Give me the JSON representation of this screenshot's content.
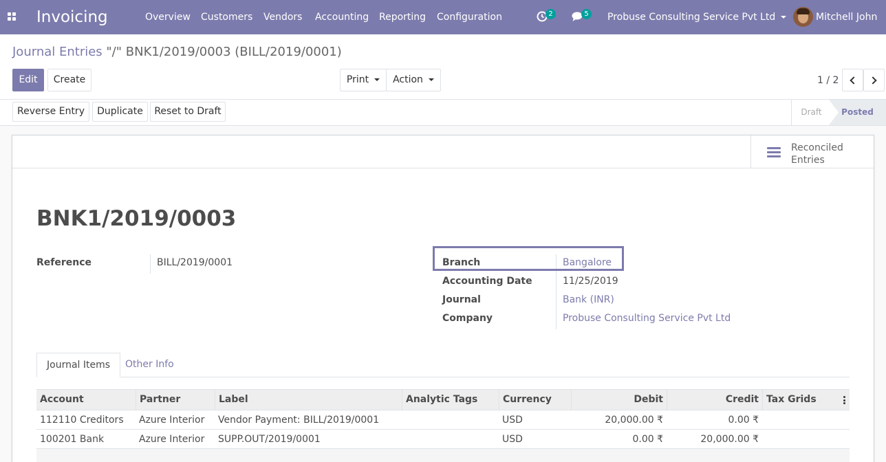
{
  "navbar": {
    "app_name": "Invoicing",
    "menu": [
      "Overview",
      "Customers",
      "Vendors",
      "Accounting",
      "Reporting",
      "Configuration"
    ],
    "activity_count": "2",
    "message_count": "5",
    "company": "Probuse Consulting Service Pvt Ltd",
    "user": "Mitchell John",
    "accent_color": "#7c7bad"
  },
  "breadcrumb": {
    "parent": "Journal Entries",
    "current": "\"/\" BNK1/2019/0003 (BILL/2019/0001)"
  },
  "buttons": {
    "edit": "Edit",
    "create": "Create",
    "print": "Print",
    "action": "Action",
    "reverse_entry": "Reverse Entry",
    "duplicate": "Duplicate",
    "reset_to_draft": "Reset to Draft"
  },
  "pager": {
    "value": "1 / 2"
  },
  "status": {
    "draft": "Draft",
    "posted": "Posted",
    "current": "Posted"
  },
  "smart_button": {
    "line1": "Reconciled",
    "line2": "Entries"
  },
  "record": {
    "name": "BNK1/2019/0003",
    "reference_label": "Reference",
    "reference": "BILL/2019/0001",
    "branch_label": "Branch",
    "branch": "Bangalore",
    "date_label": "Accounting Date",
    "date": "11/25/2019",
    "journal_label": "Journal",
    "journal": "Bank (INR)",
    "company_label": "Company",
    "company": "Probuse Consulting Service Pvt Ltd"
  },
  "tabs": {
    "journal_items": "Journal Items",
    "other_info": "Other Info",
    "active": "Journal Items"
  },
  "table": {
    "columns": [
      "Account",
      "Partner",
      "Label",
      "Analytic Tags",
      "Currency",
      "Debit",
      "Credit",
      "Tax Grids"
    ],
    "rows": [
      {
        "account": "112110 Creditors",
        "partner": "Azure Interior",
        "label": "Vendor Payment: BILL/2019/0001",
        "tags": "",
        "currency": "USD",
        "debit": "20,000.00 ₹",
        "credit": "0.00 ₹",
        "tax_grids": ""
      },
      {
        "account": "100201 Bank",
        "partner": "Azure Interior",
        "label": "SUPP.OUT/2019/0001",
        "tags": "",
        "currency": "USD",
        "debit": "0.00 ₹",
        "credit": "20,000.00 ₹",
        "tax_grids": ""
      }
    ]
  }
}
